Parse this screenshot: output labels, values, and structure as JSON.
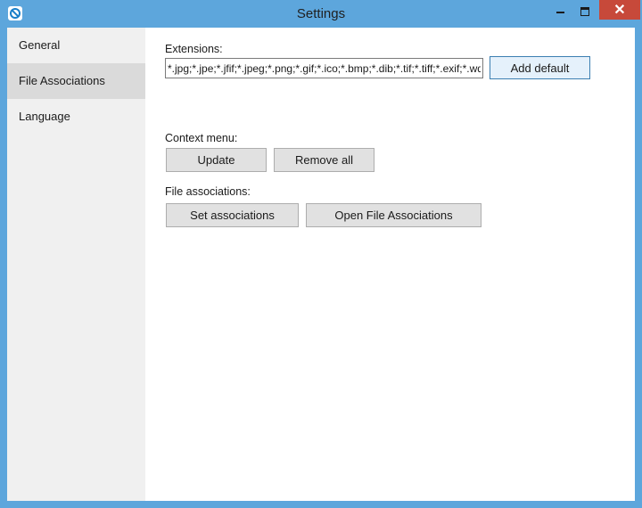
{
  "window": {
    "title": "Settings"
  },
  "sidebar": {
    "items": [
      {
        "label": "General"
      },
      {
        "label": "File Associations"
      },
      {
        "label": "Language"
      }
    ]
  },
  "extensions": {
    "label": "Extensions:",
    "value": "*.jpg;*.jpe;*.jfif;*.jpeg;*.png;*.gif;*.ico;*.bmp;*.dib;*.tif;*.tiff;*.exif;*.wdp;*.jxr",
    "add_default_label": "Add default"
  },
  "context_menu": {
    "label": "Context menu:",
    "update_label": "Update",
    "remove_all_label": "Remove all"
  },
  "file_associations": {
    "label": "File associations:",
    "set_label": "Set associations",
    "open_label": "Open File Associations"
  },
  "colors": {
    "title_bar": "#5da6dc",
    "close_button": "#c7493a",
    "sidebar": "#f0f0f0",
    "sidebar_selected": "#dadada"
  }
}
